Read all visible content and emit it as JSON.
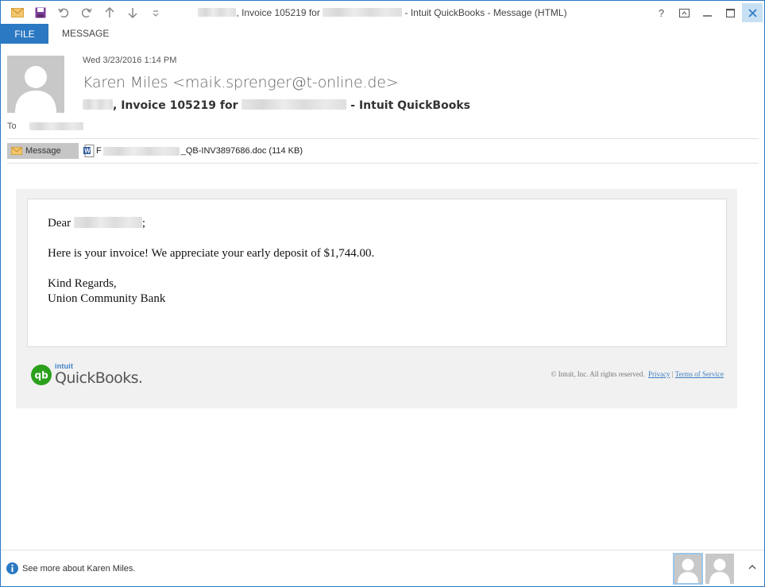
{
  "window": {
    "title_prefix": ", Invoice 105219 for",
    "title_suffix": "- Intuit QuickBooks - Message (HTML)",
    "controls": {
      "help": "?",
      "restore_ribbon": "⧉",
      "minimize": "—",
      "maximize": "☐",
      "close": "✕"
    }
  },
  "ribbon": {
    "file_tab": "FILE",
    "message_tab": "MESSAGE"
  },
  "header": {
    "date": "Wed 3/23/2016 1:14 PM",
    "sender": "Karen Miles <maik.sprenger@t-online.de>",
    "subject_mid": ", Invoice 105219 for",
    "subject_end": "- Intuit QuickBooks",
    "to_label": "To"
  },
  "attachments": {
    "message_button": "Message",
    "file_first_char": "F",
    "file_suffix": "_QB-INV3897686.doc (114 KB)"
  },
  "email": {
    "greeting_prefix": "Dear",
    "greeting_suffix": ";",
    "line1": "Here is your invoice! We appreciate your early deposit of $1,744.00.",
    "closing": "Kind Regards,",
    "signature": "Union Community Bank",
    "logo_intuit": "intuit",
    "logo_quickbooks": "QuickBooks.",
    "copyright": "© Intuit, Inc. All rights reserved.",
    "privacy_link": "Privacy",
    "separator": "|",
    "terms_link": "Terms of Service"
  },
  "people_pane": {
    "info_text": "See more about Karen Miles."
  },
  "colors": {
    "accent": "#2b79c2",
    "qb_green": "#2ca01c",
    "link": "#3f7fc0"
  }
}
